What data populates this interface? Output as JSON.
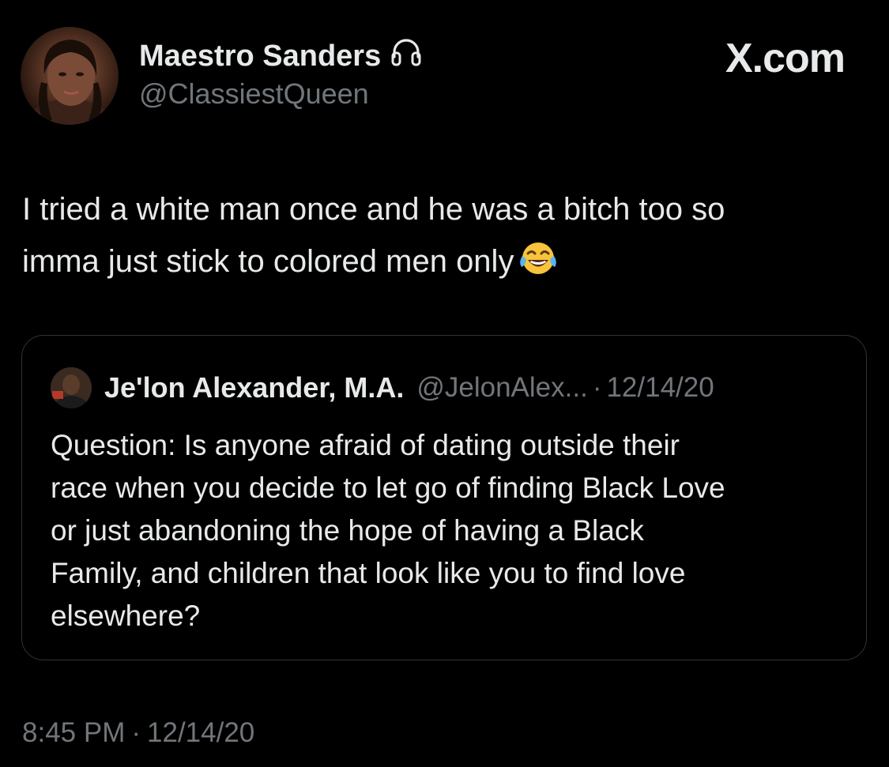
{
  "author": {
    "display_name": "Maestro Sanders",
    "handle": "@ClassiestQueen",
    "badge_icon": "headphones-icon",
    "avatar": "profile-photo"
  },
  "site_mark": "X.com",
  "tweet": {
    "lines": [
      "I tried a white man once and he was a bitch too so",
      "imma just stick to colored men only"
    ],
    "emoji": "face-with-tears-of-joy-icon"
  },
  "quoted_tweet": {
    "display_name": "Je'lon Alexander, M.A.",
    "handle": "@JelonAlex...",
    "separator": "·",
    "date": "12/14/20",
    "avatar": "profile-photo",
    "lines": [
      "Question: Is anyone afraid of dating outside their",
      "race when you decide to let go of finding Black Love",
      "or just abandoning the hope of having a Black",
      "Family, and children that look like you to find love",
      "elsewhere?"
    ]
  },
  "footer": {
    "time": "8:45 PM",
    "separator": "·",
    "date": "12/14/20"
  },
  "colors": {
    "background": "#000000",
    "primary_text": "#e7e9ea",
    "secondary_text": "#71767b",
    "border": "#2f3336"
  }
}
